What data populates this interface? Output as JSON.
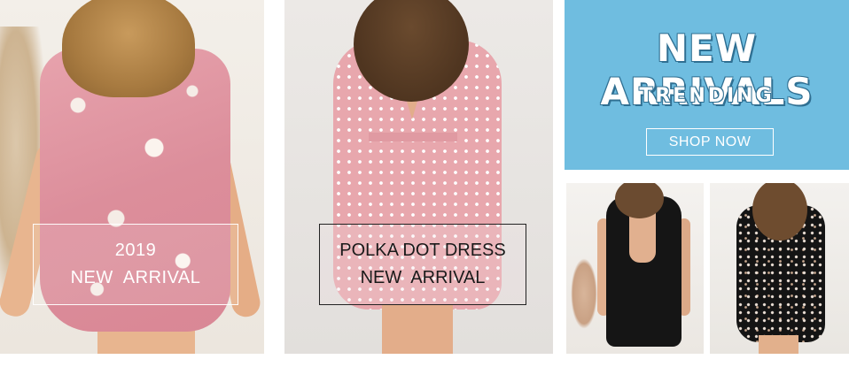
{
  "banners": [
    {
      "caption_line1": "2019",
      "caption_line2": "NEW  ARRIVAL"
    },
    {
      "caption_line1": "POLKA DOT DRESS",
      "caption_line2": "NEW  ARRIVAL"
    }
  ],
  "promo": {
    "headline": "NEW ARRIVALS",
    "subheadline": "TRENDING",
    "button_label": "SHOP NOW",
    "background_color": "#6fbde0"
  },
  "products": [
    {
      "icon": "black-backless-dress-photo"
    },
    {
      "icon": "black-floral-dress-photo"
    }
  ]
}
